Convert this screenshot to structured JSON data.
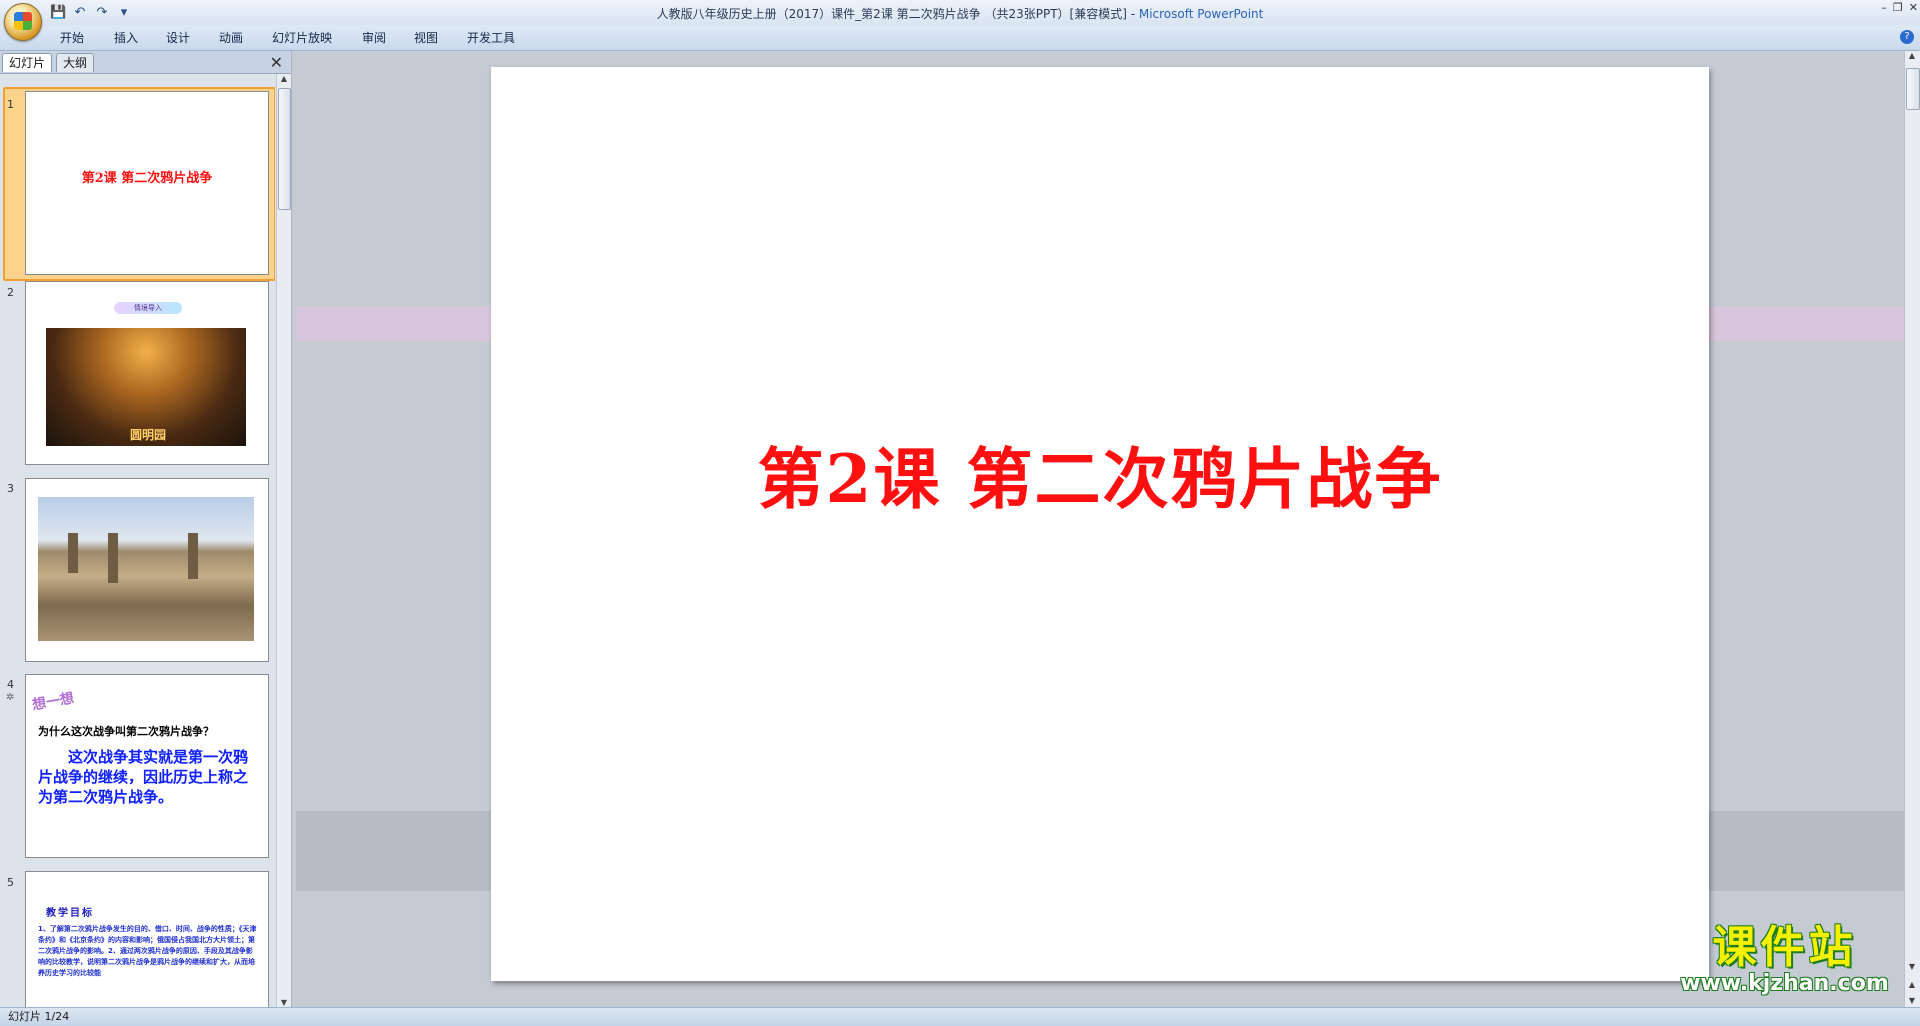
{
  "window": {
    "title": "人教版八年级历史上册（2017）课件_第2课 第二次鸦片战争 （共23张PPT）[兼容模式] - ",
    "app_name": "Microsoft PowerPoint"
  },
  "quick_access": [
    "save-icon",
    "undo-icon",
    "redo-icon",
    "customize-icon"
  ],
  "ribbon_tabs": [
    "开始",
    "插入",
    "设计",
    "动画",
    "幻灯片放映",
    "审阅",
    "视图",
    "开发工具"
  ],
  "left_pane": {
    "tabs": [
      "幻灯片",
      "大纲"
    ],
    "selected_tab": 0,
    "thumbnails": [
      {
        "num": "1",
        "title": "第2课  第二次鸦片战争"
      },
      {
        "num": "2",
        "banner": "情境导入",
        "caption": "圆明园"
      },
      {
        "num": "3"
      },
      {
        "num": "4",
        "star": "✲",
        "think": "想一想",
        "question": "为什么这次战争叫第二次鸦片战争？",
        "answer": "这次战争其实就是第一次鸦片战争的继续，因此历史上称之为第二次鸦片战争。"
      },
      {
        "num": "5",
        "heading": "教学目标",
        "body": "1、了解第二次鸦片战争发生的目的、借口、时间、战争的性质；《天津条约》和《北京条约》的内容和影响；俄国侵占我国北方大片领土；第二次鸦片战争的影响。2、通过两次鸦片战争的原因、手段及其战争影响的比较教学，说明第二次鸦片战争是鸦片战争的继续和扩大，从而培养历史学习的比较能"
      }
    ]
  },
  "slide": {
    "title": "第2课  第二次鸦片战争"
  },
  "status": {
    "slide_counter": "幻灯片 1/24"
  },
  "watermark": {
    "name": "课件站",
    "url": "www.kjzhan.com"
  },
  "colors": {
    "title_red": "#ff1010",
    "selection": "#f0a030",
    "band_purple": "#d8c6dc"
  }
}
